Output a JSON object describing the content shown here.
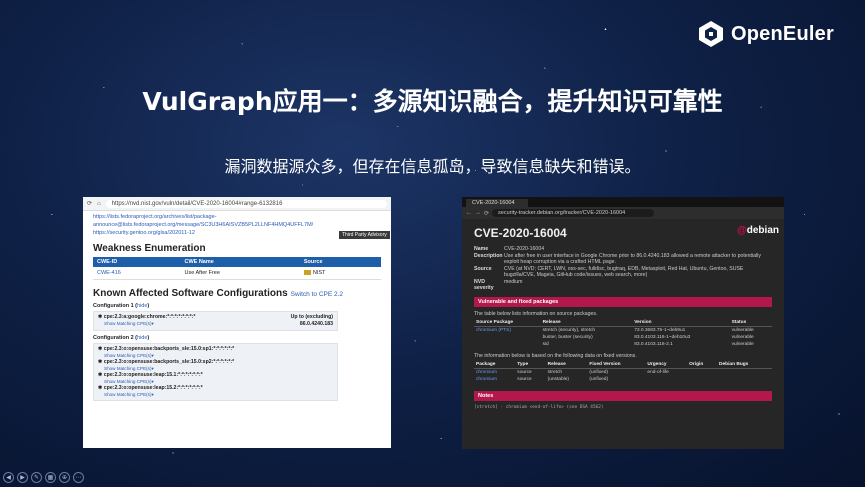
{
  "slide": {
    "brand": "OpenEuler",
    "title": "VulGraph应用一：多源知识融合，提升知识可靠性",
    "subtitle": "漏洞数据源众多，但存在信息孤岛，导致信息缺失和错误。"
  },
  "nvd": {
    "url": "https://nvd.nist.gov/vuln/detail/CVE-2020-16004#range-6132816",
    "links": [
      "https://lists.fedoraproject.org/archives/list/package-",
      "announce@lists.fedoraproject.org/message/SC3U3H6AISVZB5PL2LLNF4HMQ4UFFL7M/",
      "https://security.gentoo.org/glsa/202011-12"
    ],
    "third_party_badge": "Third Party Advisory",
    "weakness_heading": "Weakness Enumeration",
    "weakness_columns": [
      "CWE-ID",
      "CWE Name",
      "Source"
    ],
    "weakness_row": [
      "CWE-416",
      "Use After Free",
      "NIST"
    ],
    "kasc_heading": "Known Affected Software Configurations",
    "switch_cpe": "Switch to CPE 2.2",
    "config1_title": "Configuration 1",
    "hide": "hide",
    "config1_cpe": "cpe:2.3:a:google:chrome:*:*:*:*:*:*:*:*",
    "config1_upto_label": "Up to (excluding)",
    "config1_upto_value": "86.0.4240.183",
    "show_matching": "Show Matching CPE(s)▾",
    "config2_title": "Configuration 2",
    "config2_cpes": [
      "cpe:2.3:o:opensuse:backports_sle:15.0:sp1:*:*:*:*:*:*",
      "cpe:2.3:o:opensuse:backports_sle:15.0:sp2:*:*:*:*:*:*",
      "cpe:2.3:o:opensuse:leap:15.1:*:*:*:*:*:*:*",
      "cpe:2.3:o:opensuse:leap:15.2:*:*:*:*:*:*:*"
    ]
  },
  "debian": {
    "tab_title": "CVE-2020-16004",
    "url": "security-tracker.debian.org/tracker/CVE-2020-16004",
    "heading": "CVE-2020-16004",
    "logo": "debian",
    "name_label": "Name",
    "name_value": "CVE-2020-16004",
    "desc_label": "Description",
    "desc_value": "Use after free in user interface in Google Chrome prior to 86.0.4240.183 allowed a remote attacker to potentially exploit heap corruption via a crafted HTML page.",
    "source_label": "Source",
    "source_value": "CVE (at NVD; CERT, LWN, oss-sec, fulldisc, bugtraq, EDB, Metasploit, Red Hat, Ubuntu, Gentoo, SUSE bugzilla/CVE, Mageia, GitHub code/issues, web search, more)",
    "severity_label": "NVD severity",
    "severity_value": "medium",
    "vuln_bar": "Vulnerable and fixed packages",
    "vuln_note": "The table below lists information on source packages.",
    "t1_columns": [
      "Source Package",
      "Release",
      "Version",
      "Status"
    ],
    "t1_rows": [
      [
        "chromium (PTS)",
        "stretch (security), stretch",
        "73.0.3683.75-1~deb9u1",
        "vulnerable"
      ],
      [
        "",
        "buster, buster (security)",
        "83.0.4103.116-1~deb10u3",
        "vulnerable"
      ],
      [
        "",
        "sid",
        "83.0.4103.116-2.1",
        "vulnerable"
      ]
    ],
    "fixed_note": "The information below is based on the following data on fixed versions.",
    "t2_columns": [
      "Package",
      "Type",
      "Release",
      "Fixed Version",
      "Urgency",
      "Origin",
      "Debian Bugs"
    ],
    "t2_rows": [
      [
        "chromium",
        "source",
        "stretch",
        "(unfixed)",
        "end-of-life",
        "",
        ""
      ],
      [
        "chromium",
        "source",
        "(unstable)",
        "(unfixed)",
        "",
        "",
        ""
      ]
    ],
    "notes_bar": "Notes",
    "notes_text": "[stretch] - chromium <end-of-life> (see DSA 4562)"
  },
  "colors": {
    "nvd_header": "#1f5ea8",
    "debian_bar": "#b3174b",
    "vulnerable": "#ff5d5d",
    "link": "#6b9ff0"
  }
}
